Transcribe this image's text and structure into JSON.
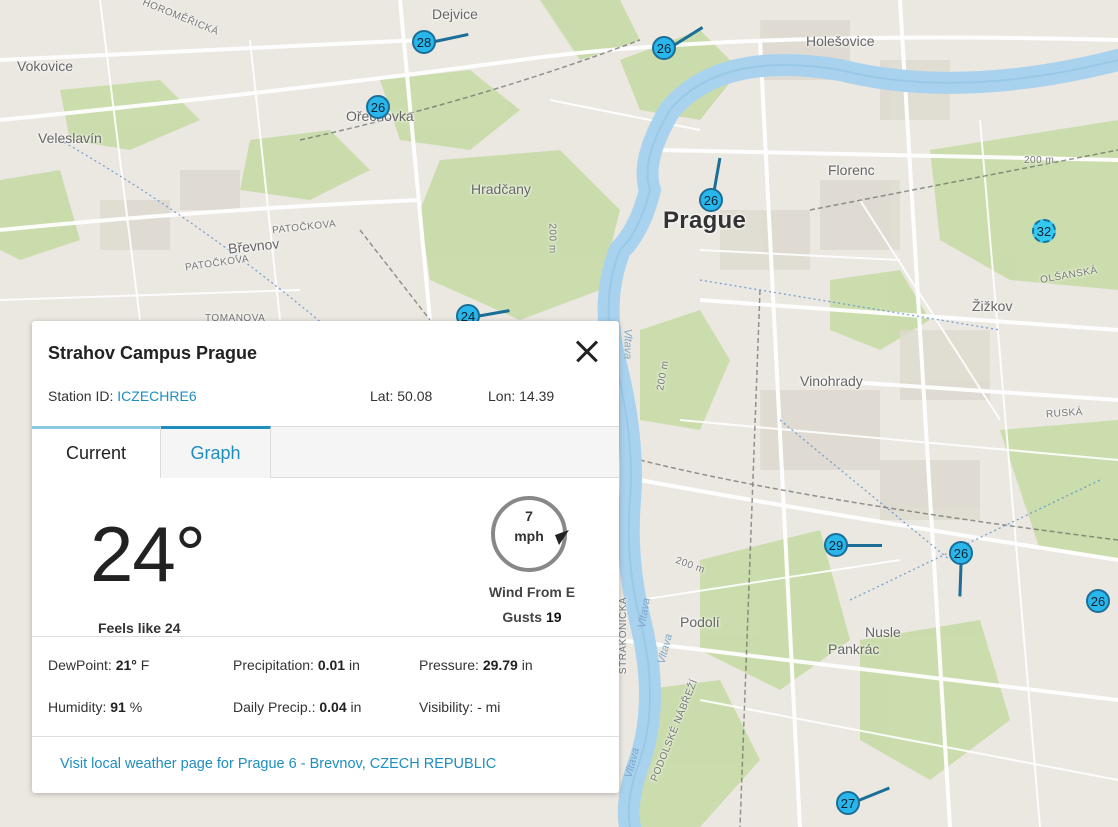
{
  "map": {
    "labels": {
      "dejvice": "Dejvice",
      "holesovice": "Holešovice",
      "vokovice": "Vokovice",
      "orechovka": "Ořechovka",
      "veleslavin": "Veleslavín",
      "hradcany": "Hradčany",
      "prague": "Prague",
      "florenc": "Florenc",
      "brevnov": "Břevnov",
      "patockova1": "PATOČKOVA",
      "patockova2": "PATOČKOVA",
      "tomanova": "TOMANOVA",
      "zizkov": "Žižkov",
      "olsanska": "OLŠANSKÁ",
      "vinohrady": "Vinohrady",
      "ruska": "RUSKÁ",
      "nusle": "Nusle",
      "pankrac": "Pankrác",
      "podoli": "Podolí",
      "vltava1": "Vltava",
      "vltava2": "Vltava",
      "vltava3": "Vltava",
      "vltava4": "Vltava",
      "podolske": "PODOLSKÉ NÁBŘEŽÍ",
      "strakonicka": "STRAKONICKÁ",
      "horomericka": "HOROMĚŘICKÁ",
      "m200a": "200 m",
      "m200b": "200 m",
      "m200c": "200 m",
      "m200d": "200 m"
    },
    "markers": [
      {
        "value": "28"
      },
      {
        "value": "26"
      },
      {
        "value": "26"
      },
      {
        "value": "26"
      },
      {
        "value": "32"
      },
      {
        "value": "24"
      },
      {
        "value": "29"
      },
      {
        "value": "26"
      },
      {
        "value": "26"
      },
      {
        "value": "27"
      }
    ]
  },
  "popup": {
    "title": "Strahov Campus Prague",
    "station_label": "Station ID: ",
    "station_id": "ICZECHRE6",
    "lat": "Lat: 50.08",
    "lon": "Lon: 14.39",
    "tabs": {
      "current": "Current",
      "graph": "Graph"
    },
    "temperature": "24°",
    "feels_like": "Feels like 24",
    "wind": {
      "speed": "7",
      "unit": "mph",
      "direction_text": "Wind From E",
      "gusts_label": "Gusts ",
      "gusts_value": "19"
    },
    "stats": {
      "dewpoint_label": "DewPoint: ",
      "dewpoint_value": "21°",
      "dewpoint_unit": " F",
      "precip_label": "Precipitation: ",
      "precip_value": "0.01",
      "precip_unit": " in",
      "pressure_label": "Pressure: ",
      "pressure_value": "29.79",
      "pressure_unit": " in",
      "humidity_label": "Humidity: ",
      "humidity_value": "91",
      "humidity_unit": " %",
      "daily_label": "Daily Precip.: ",
      "daily_value": "0.04",
      "daily_unit": " in",
      "visibility_label": "Visibility: ",
      "visibility_value": "- mi"
    },
    "visit_link": "Visit local weather page for Prague 6 - Brevnov, CZECH REPUBLIC"
  },
  "colors": {
    "accent": "#1e8ebf",
    "marker_fill": "#29b6ea",
    "marker_border": "#1a6e98",
    "water": "#aad3ec",
    "park": "#c5dba6",
    "land": "#eae7df"
  }
}
